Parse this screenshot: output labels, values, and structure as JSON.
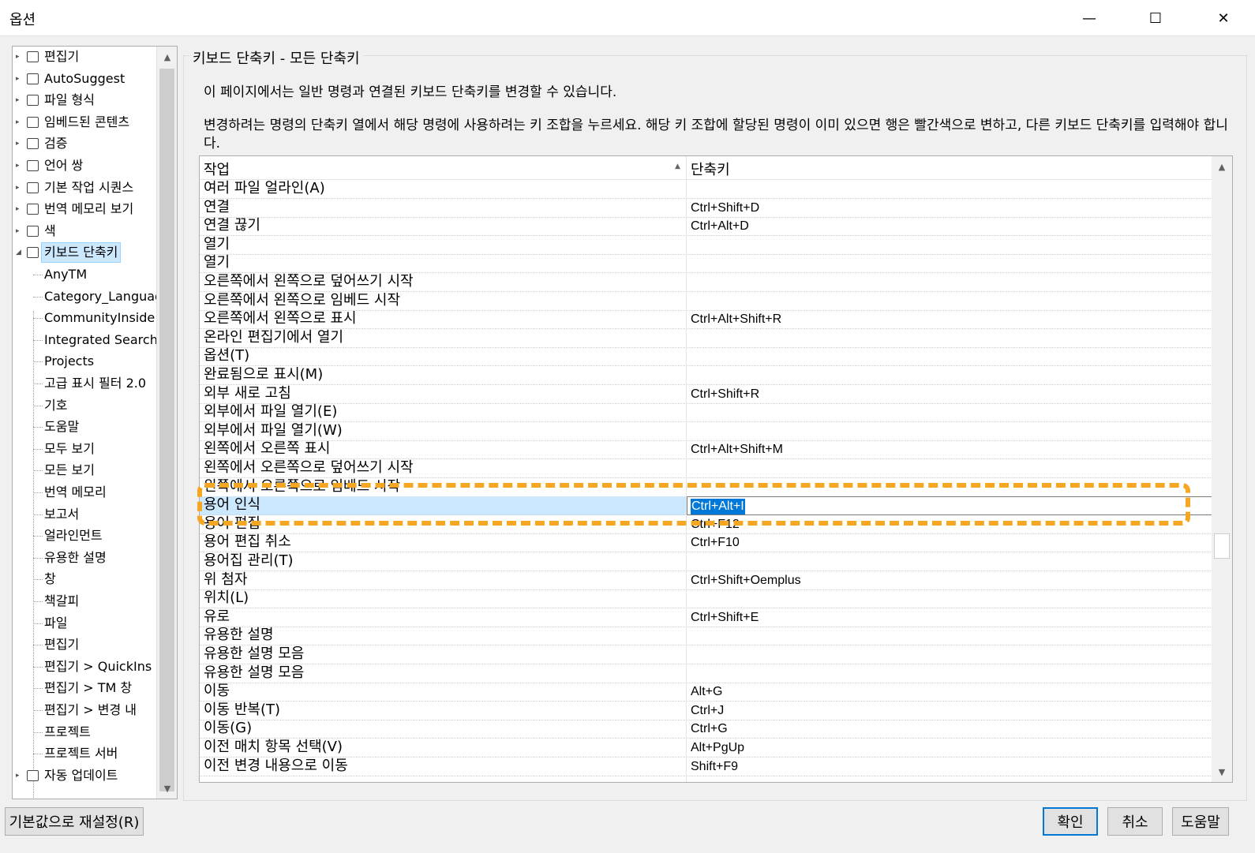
{
  "window": {
    "title": "옵션",
    "minimize": "—",
    "maximize": "☐",
    "close": "✕"
  },
  "tree": {
    "items": [
      {
        "label": "편집기",
        "arrow": "▸"
      },
      {
        "label": "AutoSuggest",
        "arrow": "▸"
      },
      {
        "label": "파일 형식",
        "arrow": "▸"
      },
      {
        "label": "임베드된 콘텐츠",
        "arrow": "▸"
      },
      {
        "label": "검증",
        "arrow": "▸"
      },
      {
        "label": "언어 쌍",
        "arrow": "▸"
      },
      {
        "label": "기본 작업 시퀀스",
        "arrow": "▸"
      },
      {
        "label": "번역 메모리 보기",
        "arrow": "▸"
      },
      {
        "label": "색",
        "arrow": "▸"
      },
      {
        "label": "키보드 단축키",
        "arrow": "◢"
      }
    ],
    "children": [
      "AnyTM",
      "Category_Languag",
      "CommunityInside",
      "Integrated Search",
      "Projects",
      "고급 표시 필터 2.0",
      "기호",
      "도움말",
      "모두 보기",
      "모든 보기",
      "번역 메모리",
      "보고서",
      "얼라인먼트",
      "유용한 설명",
      "창",
      "책갈피",
      "파일",
      "편집기",
      "편집기 > QuickIns",
      "편집기 > TM 창",
      "편집기 > 변경 내",
      "프로젝트",
      "프로젝트 서버"
    ],
    "last_item": {
      "label": "자동 업데이트",
      "arrow": "▸"
    },
    "scroll_up": "▲",
    "scroll_down": "▼"
  },
  "panel": {
    "title": "키보드 단축키 - 모든 단축키",
    "description1": "이 페이지에서는 일반 명령과 연결된 키보드 단축키를 변경할 수 있습니다.",
    "description2": "변경하려는 명령의 단축키 열에서 해당 명령에 사용하려는 키 조합을 누르세요. 해당 키 조합에 할당된 명령이 이미 있으면 행은 빨간색으로 변하고, 다른 키보드 단축키를 입력해야 합니다."
  },
  "grid": {
    "columns": [
      "작업",
      "단축키"
    ],
    "sort_icon": "▲",
    "scroll_up": "▲",
    "scroll_down": "▼",
    "selected_index": 17,
    "rows": [
      {
        "action": "여러 파일 얼라인(A)",
        "shortcut": ""
      },
      {
        "action": "연결",
        "shortcut": "Ctrl+Shift+D"
      },
      {
        "action": "연결 끊기",
        "shortcut": "Ctrl+Alt+D"
      },
      {
        "action": "열기",
        "shortcut": ""
      },
      {
        "action": "열기",
        "shortcut": ""
      },
      {
        "action": "오른쪽에서 왼쪽으로 덮어쓰기 시작",
        "shortcut": ""
      },
      {
        "action": "오른쪽에서 왼쪽으로 임베드 시작",
        "shortcut": ""
      },
      {
        "action": "오른쪽에서 왼쪽으로 표시",
        "shortcut": "Ctrl+Alt+Shift+R"
      },
      {
        "action": "온라인 편집기에서 열기",
        "shortcut": ""
      },
      {
        "action": "옵션(T)",
        "shortcut": ""
      },
      {
        "action": "완료됨으로 표시(M)",
        "shortcut": ""
      },
      {
        "action": "외부 새로 고침",
        "shortcut": "Ctrl+Shift+R"
      },
      {
        "action": "외부에서 파일 열기(E)",
        "shortcut": ""
      },
      {
        "action": "외부에서 파일 열기(W)",
        "shortcut": ""
      },
      {
        "action": "왼쪽에서 오른쪽 표시",
        "shortcut": "Ctrl+Alt+Shift+M"
      },
      {
        "action": "왼쪽에서 오른쪽으로 덮어쓰기 시작",
        "shortcut": ""
      },
      {
        "action": "왼쪽에서 오른쪽으로 임베드 시작",
        "shortcut": ""
      },
      {
        "action": "용어 인식",
        "shortcut": "Ctrl+Alt+I"
      },
      {
        "action": "용어 편집",
        "shortcut": "Ctrl+F12"
      },
      {
        "action": "용어 편집 취소",
        "shortcut": "Ctrl+F10"
      },
      {
        "action": "용어집 관리(T)",
        "shortcut": ""
      },
      {
        "action": "위 첨자",
        "shortcut": "Ctrl+Shift+Oemplus"
      },
      {
        "action": "위치(L)",
        "shortcut": ""
      },
      {
        "action": "유로",
        "shortcut": "Ctrl+Shift+E"
      },
      {
        "action": "유용한 설명",
        "shortcut": ""
      },
      {
        "action": "유용한 설명 모음",
        "shortcut": ""
      },
      {
        "action": "유용한 설명 모음",
        "shortcut": ""
      },
      {
        "action": "이동",
        "shortcut": "Alt+G"
      },
      {
        "action": "이동 반복(T)",
        "shortcut": "Ctrl+J"
      },
      {
        "action": "이동(G)",
        "shortcut": "Ctrl+G"
      },
      {
        "action": "이전 매치 항목 선택(V)",
        "shortcut": "Alt+PgUp"
      },
      {
        "action": "이전 변경 내용으로 이동",
        "shortcut": "Shift+F9"
      }
    ]
  },
  "buttons": {
    "reset": "기본값으로 재설정(R)",
    "ok": "확인",
    "cancel": "취소",
    "help": "도움말"
  },
  "colors": {
    "selection": "#cce8ff",
    "highlight": "#f5a623",
    "edit_selection": "#0078d7"
  }
}
